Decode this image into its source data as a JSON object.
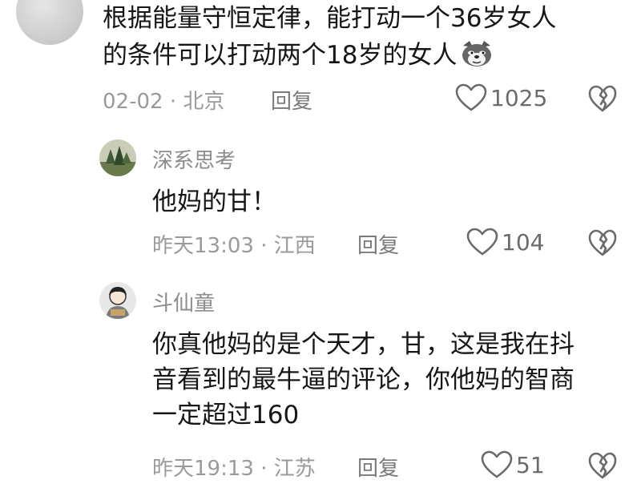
{
  "comments": [
    {
      "text_line1": "根据能量守恒定律，能打动一个36岁女人",
      "text_line2": "的条件可以打动两个18岁的女人",
      "date": "02-02 · 北京",
      "reply_label": "回复",
      "likes": "1025"
    },
    {
      "username": "深系思考",
      "text": "他妈的甘！",
      "date": "昨天13:03 · 江西",
      "reply_label": "回复",
      "likes": "104"
    },
    {
      "username": "斗仙童",
      "text_line1": "你真他妈的是个天才，甘，这是我在抖",
      "text_line2": "音看到的最牛逼的评论，你他妈的智商",
      "text_line3": "一定超过160",
      "date": "昨天19:13 · 江苏",
      "reply_label": "回复",
      "likes": "51"
    }
  ],
  "icons": {
    "like": "heart-outline-icon",
    "dislike": "broken-heart-icon",
    "emoji": "dog-face-emoji-icon"
  }
}
